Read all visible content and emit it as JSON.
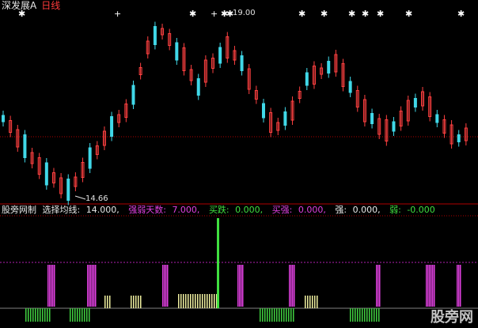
{
  "header": {
    "stock": "深发展A",
    "period": "日线"
  },
  "price_marks": {
    "high": "19.00",
    "low": "14.66"
  },
  "indicator": {
    "name": "股旁网制",
    "items": [
      {
        "label": "选择均线:",
        "value": "14.000,",
        "color": "#e6e6e6"
      },
      {
        "label": "强弱天数:",
        "value": "7.000,",
        "color": "#e040e0"
      },
      {
        "label": "买跌:",
        "value": "0.000,",
        "color": "#40e040"
      },
      {
        "label": "买强:",
        "value": "0.000,",
        "color": "#e040e0"
      },
      {
        "label": "强:",
        "value": "0.000,",
        "color": "#e8e8e8"
      },
      {
        "label": "弱:",
        "value": "-0.000",
        "color": "#40e040"
      }
    ]
  },
  "watermark": "股旁网"
}
